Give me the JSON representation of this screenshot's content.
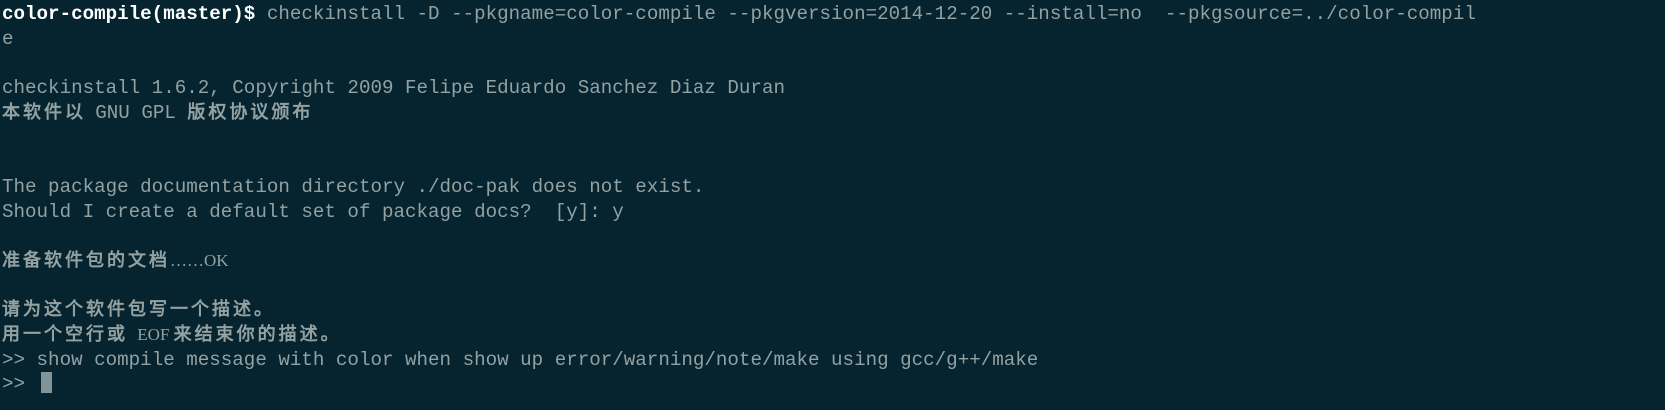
{
  "terminal": {
    "prompt": "color-compile(master)$ ",
    "command": "checkinstall -D --pkgname=color-compile --pkgversion=2014-12-20 --install=no  --pkgsource=../color-compil",
    "command_wrap": "e",
    "version_line": "checkinstall 1.6.2, Copyright 2009 Felipe Eduardo Sanchez Diaz Duran",
    "license_pre": "本软件以 ",
    "license_gnu": "GNU GPL ",
    "license_post": "版权协议颁布",
    "doc_missing": "The package documentation directory ./doc-pak does not exist.",
    "doc_question": "Should I create a default set of package docs?  [y]: y",
    "preparing": "准备软件包的文档",
    "preparing_ok": "……OK",
    "describe_prompt": "请为这个软件包写一个描述。",
    "describe_end_pre": "用一个空行或 ",
    "describe_end_eof": "EOF ",
    "describe_end_post": "来结束你的描述。",
    "input_prompt": ">> ",
    "description_line": "show compile message with color when show up error/warning/note/make using gcc/g++/make",
    "current_prompt": ">> "
  }
}
